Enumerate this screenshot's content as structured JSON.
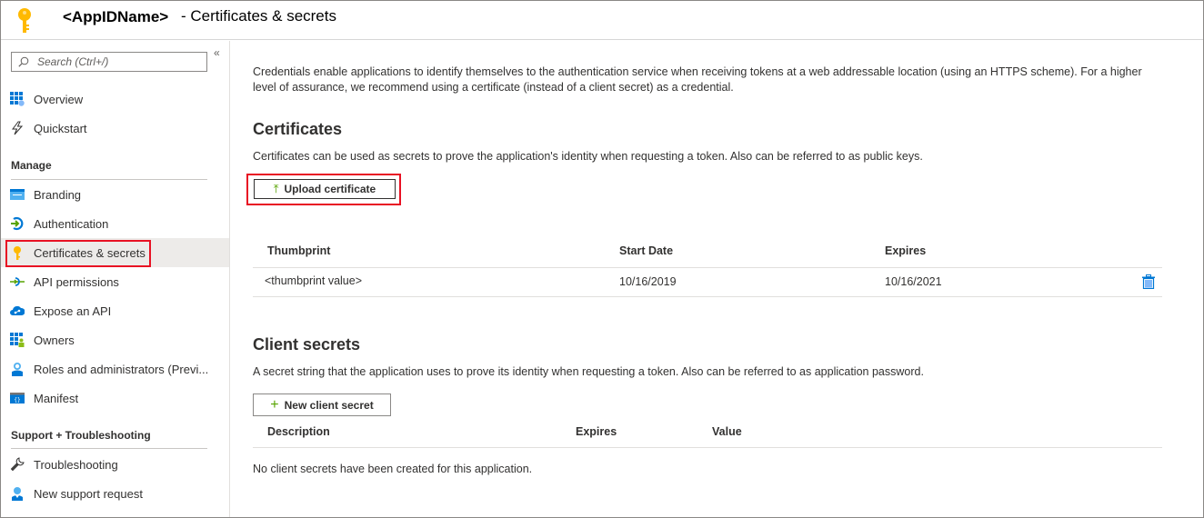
{
  "header": {
    "app_name": "<AppIDName>",
    "page_title": "- Certificates & secrets"
  },
  "sidebar": {
    "search_placeholder": "Search (Ctrl+/)",
    "collapse_glyph": "«",
    "top_items": [
      {
        "label": "Overview",
        "icon": "overview-grid-icon"
      },
      {
        "label": "Quickstart",
        "icon": "lightning-icon"
      }
    ],
    "manage_label": "Manage",
    "manage_items": [
      {
        "label": "Branding",
        "icon": "branding-icon"
      },
      {
        "label": "Authentication",
        "icon": "authentication-icon"
      },
      {
        "label": "Certificates & secrets",
        "icon": "key-icon",
        "active": true
      },
      {
        "label": "API permissions",
        "icon": "api-permissions-icon"
      },
      {
        "label": "Expose an API",
        "icon": "cloud-icon"
      },
      {
        "label": "Owners",
        "icon": "owners-icon"
      },
      {
        "label": "Roles and administrators (Previ...",
        "icon": "roles-icon"
      },
      {
        "label": "Manifest",
        "icon": "manifest-icon"
      }
    ],
    "support_label": "Support + Troubleshooting",
    "support_items": [
      {
        "label": "Troubleshooting",
        "icon": "wrench-icon"
      },
      {
        "label": "New support request",
        "icon": "support-person-icon"
      }
    ]
  },
  "main": {
    "intro": "Credentials enable applications to identify themselves to the authentication service when receiving tokens at a web addressable location (using an HTTPS scheme). For a higher level of assurance, we recommend using a certificate (instead of a client secret) as a credential.",
    "certificates": {
      "title": "Certificates",
      "description": "Certificates can be used as secrets to prove the application's identity when requesting a token. Also can be referred to as public keys.",
      "upload_button": "Upload certificate",
      "columns": [
        "Thumbprint",
        "Start Date",
        "Expires"
      ],
      "rows": [
        {
          "thumbprint": "<thumbprint value>",
          "start_date": "10/16/2019",
          "expires": "10/16/2021"
        }
      ]
    },
    "client_secrets": {
      "title": "Client secrets",
      "description": "A secret string that the application uses to prove its identity when requesting a token. Also can be referred to as application password.",
      "new_button": "New client secret",
      "columns": [
        "Description",
        "Expires",
        "Value"
      ],
      "empty_message": "No client secrets have been created for this application."
    }
  },
  "colors": {
    "highlight": "#e81123",
    "accent_green": "#57a300",
    "azure_blue": "#0078d4",
    "key_yellow": "#ffb900"
  }
}
